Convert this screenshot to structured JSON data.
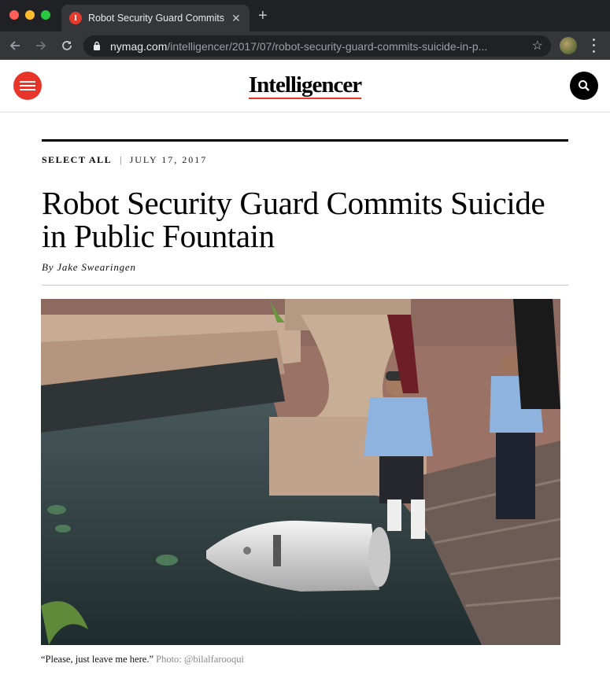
{
  "browser": {
    "tab_title": "Robot Security Guard Commits Suicide in Public Fountain",
    "favicon_letter": "I",
    "url_host": "nymag.com",
    "url_path": "/intelligencer/2017/07/robot-security-guard-commits-suicide-in-p..."
  },
  "site": {
    "logo": "Intelligencer"
  },
  "article": {
    "section": "SELECT ALL",
    "separator": "|",
    "date": "JULY 17, 2017",
    "headline": "Robot Security Guard Commits Suicide in Public Fountain",
    "byline": "By Jake Swearingen",
    "caption": "“Please, just leave me here.”",
    "photo_credit": "Photo: @bilalfarooqui"
  },
  "colors": {
    "accent": "#e8352a",
    "chrome_dark": "#202124",
    "chrome_toolbar": "#35363a"
  },
  "icons": [
    "back-arrow-icon",
    "forward-arrow-icon",
    "reload-icon",
    "lock-icon",
    "star-icon",
    "menu-icon",
    "search-icon",
    "close-icon",
    "plus-icon"
  ]
}
